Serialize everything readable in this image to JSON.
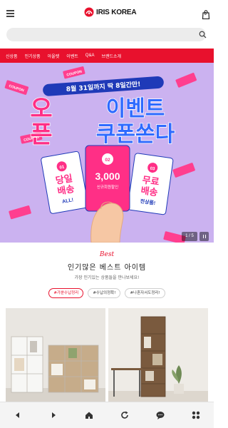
{
  "header": {
    "brand": "IRIS KOREA",
    "cart_count": "0"
  },
  "search": {
    "placeholder": "",
    "value": ""
  },
  "nav": {
    "items": [
      "신상품",
      "인기상품",
      "아울렛",
      "이벤트",
      "Q&A",
      "브랜드소개"
    ]
  },
  "banner": {
    "date_line": "8월 31일까지 딱 8일간만!",
    "title_left_top": "오",
    "title_left_bottom": "픈",
    "title_right_top": "이벤트",
    "title_right_bottom": "쿠폰쏜다",
    "coupon_label": "COUPON",
    "ticket1_num": "01",
    "ticket1_line1": "당일",
    "ticket1_line2": "배송",
    "ticket1_sub": "ALL!",
    "ticket2_num": "02",
    "ticket2_amount": "3,000",
    "ticket2_sub": "신규회원할인",
    "ticket3_num": "03",
    "ticket3_line1": "무료",
    "ticket3_line2": "배송",
    "ticket3_sub": "전상품!",
    "slide_counter": "1 / 5"
  },
  "best": {
    "script": "Best",
    "title": "인기많은 베스트 아이템",
    "subtitle": "가장 인기있는 상품들을 만나보세요!",
    "tags": [
      "#가뿐수납정리",
      "#수납의정확!",
      "#나혼자서도정리!"
    ]
  },
  "colors": {
    "accent": "#e8112d",
    "banner_bg": "#cbb2f0",
    "ticket_pink": "#ff2f86",
    "title_blue": "#2f6bff"
  },
  "bottom_bar": {
    "icons": [
      "back-arrow-icon",
      "forward-arrow-icon",
      "home-icon",
      "refresh-icon",
      "chat-icon",
      "apps-icon"
    ]
  }
}
